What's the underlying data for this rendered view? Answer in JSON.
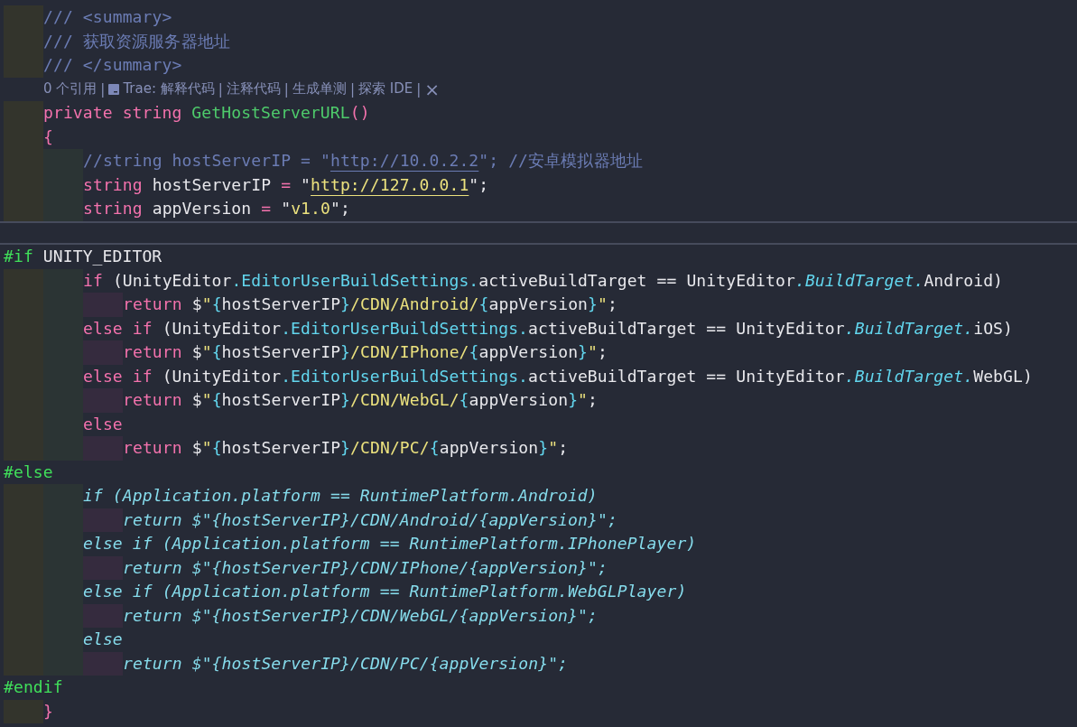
{
  "editor": {
    "lines": [
      {
        "kind": "block",
        "children": [
          {
            "kind": "code",
            "tokens": [
              {
                "kind": "comment",
                "text": "/// <summary>"
              }
            ]
          },
          {
            "kind": "code",
            "tokens": [
              {
                "kind": "comment",
                "text": "/// 获取资源服务器地址"
              }
            ]
          },
          {
            "kind": "code",
            "tokens": [
              {
                "kind": "comment",
                "text": "/// </summary>"
              }
            ]
          }
        ]
      },
      {
        "kind": "codelens",
        "tokens": [
          {
            "kind": "link",
            "text": "0 个引用"
          },
          {
            "kind": "sep",
            "text": "|"
          },
          {
            "kind": "icon"
          },
          {
            "kind": "link",
            "text": "Trae: 解释代码"
          },
          {
            "kind": "sep",
            "text": "|"
          },
          {
            "kind": "link",
            "text": "注释代码"
          },
          {
            "kind": "sep",
            "text": "|"
          },
          {
            "kind": "link",
            "text": "生成单测"
          },
          {
            "kind": "sep",
            "text": "|"
          },
          {
            "kind": "link",
            "text": "探索 IDE"
          },
          {
            "kind": "sep",
            "text": "|"
          },
          {
            "kind": "close",
            "text": "×"
          }
        ]
      },
      {
        "kind": "block",
        "children": [
          {
            "kind": "code",
            "tokens": [
              {
                "kind": "kw",
                "text": "private string "
              },
              {
                "kind": "fn",
                "text": "GetHostServerURL"
              },
              {
                "kind": "kw",
                "text": "()"
              }
            ]
          },
          {
            "kind": "code",
            "tokens": [
              {
                "kind": "kw",
                "text": "{"
              }
            ]
          },
          {
            "kind": "block",
            "children": [
              {
                "kind": "code",
                "tokens": [
                  {
                    "kind": "comment",
                    "text": "//string hostServerIP = \""
                  },
                  {
                    "kind": "commenturl",
                    "text": "http://10.0.2.2"
                  },
                  {
                    "kind": "comment",
                    "text": "\"; //安卓模拟器地址"
                  }
                ]
              },
              {
                "kind": "code",
                "tokens": [
                  {
                    "kind": "kw",
                    "text": "string "
                  },
                  {
                    "kind": "plain",
                    "text": "hostServerIP "
                  },
                  {
                    "kind": "kw",
                    "text": "="
                  },
                  {
                    "kind": "plain",
                    "text": " \""
                  },
                  {
                    "kind": "url",
                    "text": "http://127.0.0.1"
                  },
                  {
                    "kind": "plain",
                    "text": "\";"
                  }
                ]
              },
              {
                "kind": "code",
                "tokens": [
                  {
                    "kind": "kw",
                    "text": "string "
                  },
                  {
                    "kind": "plain",
                    "text": "appVersion "
                  },
                  {
                    "kind": "kw",
                    "text": "="
                  },
                  {
                    "kind": "plain",
                    "text": " \""
                  },
                  {
                    "kind": "str",
                    "text": "v1.0"
                  },
                  {
                    "kind": "plain",
                    "text": "\";"
                  }
                ]
              }
            ]
          }
        ]
      },
      {
        "kind": "code",
        "current": true
      },
      {
        "kind": "code",
        "tokens": [
          {
            "kind": "pre",
            "text": "#if"
          },
          {
            "kind": "plain",
            "text": " UNITY_EDITOR"
          }
        ]
      },
      {
        "kind": "block",
        "children": [
          {
            "kind": "block",
            "children": [
              {
                "kind": "code",
                "tokens": [
                  {
                    "kind": "kw",
                    "text": "if"
                  },
                  {
                    "kind": "plain",
                    "text": " (UnityEditor"
                  },
                  {
                    "kind": "type",
                    "text": ".EditorUserBuildSettings."
                  },
                  {
                    "kind": "plain",
                    "text": "activeBuildTarget == UnityEditor"
                  },
                  {
                    "kind": "typei",
                    "text": ".BuildTarget."
                  },
                  {
                    "kind": "plain",
                    "text": "Android)"
                  }
                ]
              },
              {
                "kind": "block",
                "children": [
                  {
                    "kind": "code",
                    "tokens": [
                      {
                        "kind": "kw",
                        "text": "return"
                      },
                      {
                        "kind": "plain",
                        "text": " $"
                      },
                      {
                        "kind": "str",
                        "text": "\""
                      },
                      {
                        "kind": "type",
                        "text": "{"
                      },
                      {
                        "kind": "plain",
                        "text": "hostServerIP"
                      },
                      {
                        "kind": "type",
                        "text": "}"
                      },
                      {
                        "kind": "str",
                        "text": "/CDN/Android/"
                      },
                      {
                        "kind": "type",
                        "text": "{"
                      },
                      {
                        "kind": "plain",
                        "text": "appVersion"
                      },
                      {
                        "kind": "type",
                        "text": "}"
                      },
                      {
                        "kind": "str",
                        "text": "\""
                      },
                      {
                        "kind": "plain",
                        "text": ";"
                      }
                    ]
                  }
                ]
              },
              {
                "kind": "code",
                "tokens": [
                  {
                    "kind": "kw",
                    "text": "else if"
                  },
                  {
                    "kind": "plain",
                    "text": " (UnityEditor"
                  },
                  {
                    "kind": "type",
                    "text": ".EditorUserBuildSettings."
                  },
                  {
                    "kind": "plain",
                    "text": "activeBuildTarget == UnityEditor"
                  },
                  {
                    "kind": "typei",
                    "text": ".BuildTarget."
                  },
                  {
                    "kind": "plain",
                    "text": "iOS)"
                  }
                ]
              },
              {
                "kind": "block",
                "children": [
                  {
                    "kind": "code",
                    "tokens": [
                      {
                        "kind": "kw",
                        "text": "return"
                      },
                      {
                        "kind": "plain",
                        "text": " $"
                      },
                      {
                        "kind": "str",
                        "text": "\""
                      },
                      {
                        "kind": "type",
                        "text": "{"
                      },
                      {
                        "kind": "plain",
                        "text": "hostServerIP"
                      },
                      {
                        "kind": "type",
                        "text": "}"
                      },
                      {
                        "kind": "str",
                        "text": "/CDN/IPhone/"
                      },
                      {
                        "kind": "type",
                        "text": "{"
                      },
                      {
                        "kind": "plain",
                        "text": "appVersion"
                      },
                      {
                        "kind": "type",
                        "text": "}"
                      },
                      {
                        "kind": "str",
                        "text": "\""
                      },
                      {
                        "kind": "plain",
                        "text": ";"
                      }
                    ]
                  }
                ]
              },
              {
                "kind": "code",
                "tokens": [
                  {
                    "kind": "kw",
                    "text": "else if"
                  },
                  {
                    "kind": "plain",
                    "text": " (UnityEditor"
                  },
                  {
                    "kind": "type",
                    "text": ".EditorUserBuildSettings."
                  },
                  {
                    "kind": "plain",
                    "text": "activeBuildTarget == UnityEditor"
                  },
                  {
                    "kind": "typei",
                    "text": ".BuildTarget."
                  },
                  {
                    "kind": "plain",
                    "text": "WebGL)"
                  }
                ]
              },
              {
                "kind": "block",
                "children": [
                  {
                    "kind": "code",
                    "tokens": [
                      {
                        "kind": "kw",
                        "text": "return"
                      },
                      {
                        "kind": "plain",
                        "text": " $"
                      },
                      {
                        "kind": "str",
                        "text": "\""
                      },
                      {
                        "kind": "type",
                        "text": "{"
                      },
                      {
                        "kind": "plain",
                        "text": "hostServerIP"
                      },
                      {
                        "kind": "type",
                        "text": "}"
                      },
                      {
                        "kind": "str",
                        "text": "/CDN/WebGL/"
                      },
                      {
                        "kind": "type",
                        "text": "{"
                      },
                      {
                        "kind": "plain",
                        "text": "appVersion"
                      },
                      {
                        "kind": "type",
                        "text": "}"
                      },
                      {
                        "kind": "str",
                        "text": "\""
                      },
                      {
                        "kind": "plain",
                        "text": ";"
                      }
                    ]
                  }
                ]
              },
              {
                "kind": "code",
                "tokens": [
                  {
                    "kind": "kw",
                    "text": "else"
                  }
                ]
              },
              {
                "kind": "block",
                "children": [
                  {
                    "kind": "code",
                    "tokens": [
                      {
                        "kind": "kw",
                        "text": "return"
                      },
                      {
                        "kind": "plain",
                        "text": " $"
                      },
                      {
                        "kind": "str",
                        "text": "\""
                      },
                      {
                        "kind": "type",
                        "text": "{"
                      },
                      {
                        "kind": "plain",
                        "text": "hostServerIP"
                      },
                      {
                        "kind": "type",
                        "text": "}"
                      },
                      {
                        "kind": "str",
                        "text": "/CDN/PC/"
                      },
                      {
                        "kind": "type",
                        "text": "{"
                      },
                      {
                        "kind": "plain",
                        "text": "appVersion"
                      },
                      {
                        "kind": "type",
                        "text": "}"
                      },
                      {
                        "kind": "str",
                        "text": "\""
                      },
                      {
                        "kind": "plain",
                        "text": ";"
                      }
                    ]
                  }
                ]
              }
            ]
          }
        ]
      },
      {
        "kind": "code",
        "tokens": [
          {
            "kind": "pre",
            "text": "#else"
          }
        ]
      },
      {
        "kind": "block",
        "children": [
          {
            "kind": "block",
            "children": [
              {
                "kind": "code",
                "tokens": [
                  {
                    "kind": "dim",
                    "text": "if (Application.platform == RuntimePlatform.Android)"
                  }
                ]
              },
              {
                "kind": "block",
                "children": [
                  {
                    "kind": "code",
                    "tokens": [
                      {
                        "kind": "dim",
                        "text": "return $\"{hostServerIP}/CDN/Android/{appVersion}\";"
                      }
                    ]
                  }
                ]
              },
              {
                "kind": "code",
                "tokens": [
                  {
                    "kind": "dim",
                    "text": "else if (Application.platform == RuntimePlatform.IPhonePlayer)"
                  }
                ]
              },
              {
                "kind": "block",
                "children": [
                  {
                    "kind": "code",
                    "tokens": [
                      {
                        "kind": "dim",
                        "text": "return $\"{hostServerIP}/CDN/IPhone/{appVersion}\";"
                      }
                    ]
                  }
                ]
              },
              {
                "kind": "code",
                "tokens": [
                  {
                    "kind": "dim",
                    "text": "else if (Application.platform == RuntimePlatform.WebGLPlayer)"
                  }
                ]
              },
              {
                "kind": "block",
                "children": [
                  {
                    "kind": "code",
                    "tokens": [
                      {
                        "kind": "dim",
                        "text": "return $\"{hostServerIP}/CDN/WebGL/{appVersion}\";"
                      }
                    ]
                  }
                ]
              },
              {
                "kind": "code",
                "tokens": [
                  {
                    "kind": "dim",
                    "text": "else"
                  }
                ]
              },
              {
                "kind": "block",
                "children": [
                  {
                    "kind": "code",
                    "tokens": [
                      {
                        "kind": "dim",
                        "text": "return $\"{hostServerIP}/CDN/PC/{appVersion}\";"
                      }
                    ]
                  }
                ]
              }
            ]
          }
        ]
      },
      {
        "kind": "code",
        "tokens": [
          {
            "kind": "pre",
            "text": "#endif"
          }
        ]
      },
      {
        "kind": "block",
        "children": [
          {
            "kind": "code",
            "tokens": [
              {
                "kind": "kw",
                "text": "}"
              }
            ]
          }
        ]
      }
    ]
  }
}
